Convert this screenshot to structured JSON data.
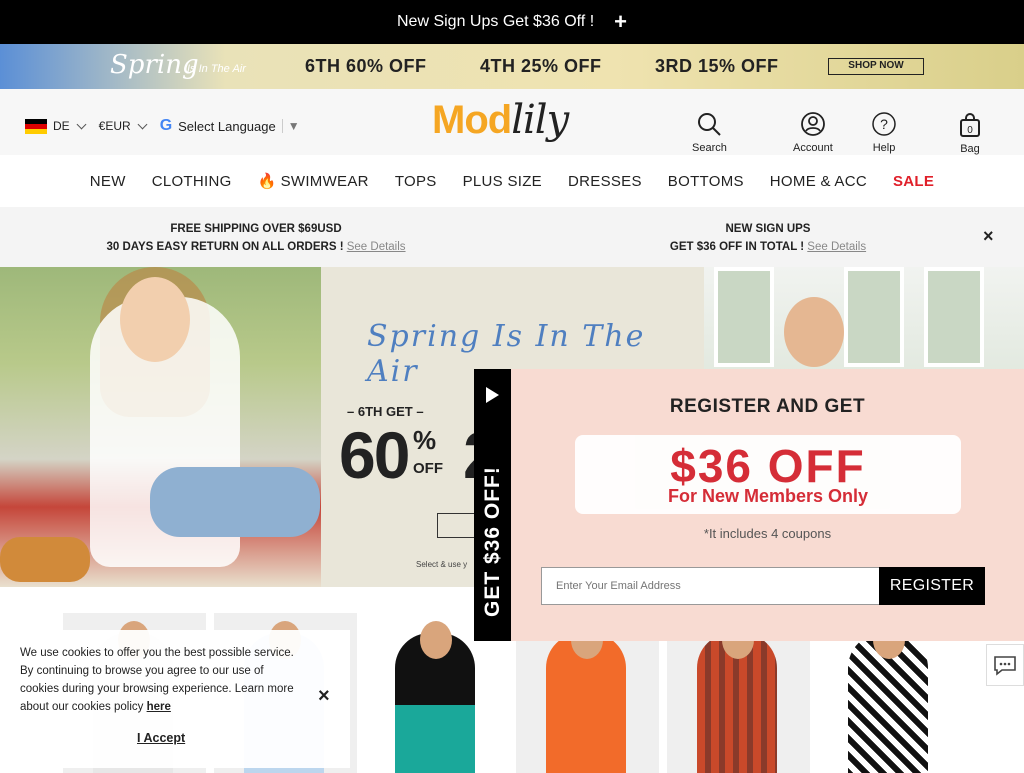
{
  "topbar": {
    "text": "New Sign Ups Get $36 Off !",
    "plus": "+"
  },
  "promo": {
    "spring": "Spring",
    "spring_sub": "Is In The Air",
    "offers": [
      "6TH 60% OFF",
      "4TH 25% OFF",
      "3RD 15% OFF"
    ],
    "shop_now": "SHOP NOW"
  },
  "header": {
    "country": "DE",
    "currency": "€EUR",
    "google_g": "G",
    "language": "Select Language",
    "logo_mod": "Mod",
    "logo_lily": "lily",
    "icons": {
      "search": "Search",
      "account": "Account",
      "help": "Help",
      "bag": "Bag",
      "bag_count": "0"
    }
  },
  "nav": [
    "NEW",
    "CLOTHING",
    "SWIMWEAR",
    "TOPS",
    "PLUS SIZE",
    "DRESSES",
    "BOTTOMS",
    "HOME & ACC",
    "SALE"
  ],
  "infobar": {
    "left_line1": "FREE SHIPPING OVER $69USD",
    "left_line2": "30 DAYS EASY RETURN ON ALL ORDERS !",
    "right_line1": "NEW SIGN UPS",
    "right_line2": "GET $36 OFF IN TOTAL !",
    "see_details": "See Details",
    "close": "×"
  },
  "hero": {
    "spring": "Spring Is In The Air",
    "get6": "– 6TH GET –",
    "pct": "60",
    "pct_sign": "%",
    "off": "OFF",
    "two": "2",
    "select_text": "Select & use y"
  },
  "popup": {
    "tab_text": "GET $36 OFF!",
    "title": "REGISTER AND GET",
    "amount": "$36 OFF",
    "members": "For New Members Only",
    "note": "*It includes 4 coupons",
    "email_placeholder": "Enter Your Email Address",
    "register": "REGISTER"
  },
  "cookie": {
    "text": "We use cookies to offer you the best possible service. By continuing to browse you agree to our use of cookies during your browsing experience. Learn more about our cookies policy",
    "link": "here",
    "close": "×",
    "accept": "I Accept"
  },
  "colors": {
    "sale": "#e0202a",
    "logo_accent": "#f5a623",
    "popup_bg": "#f8dbd2",
    "coupon_red": "#d4242f"
  }
}
